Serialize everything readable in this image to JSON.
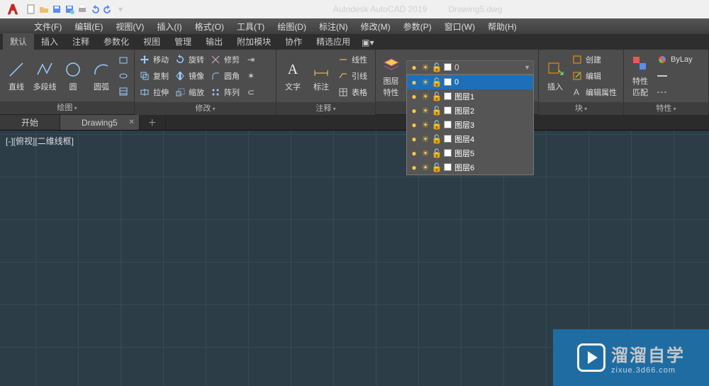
{
  "title": {
    "app": "Autodesk AutoCAD 2019",
    "file": "Drawing5.dwg"
  },
  "menu": [
    "文件(F)",
    "编辑(E)",
    "视图(V)",
    "插入(I)",
    "格式(O)",
    "工具(T)",
    "绘图(D)",
    "标注(N)",
    "修改(M)",
    "参数(P)",
    "窗口(W)",
    "帮助(H)"
  ],
  "tabs": [
    "默认",
    "插入",
    "注释",
    "参数化",
    "视图",
    "管理",
    "输出",
    "附加模块",
    "协作",
    "精选应用"
  ],
  "active_tab": 0,
  "panels": {
    "draw": {
      "title": "绘图",
      "btns": {
        "line": "直线",
        "polyline": "多段线",
        "circle": "圆",
        "arc": "圆弧"
      }
    },
    "modify": {
      "title": "修改",
      "btns": {
        "move": "移动",
        "rotate": "旋转",
        "trim": "修剪",
        "copy": "复制",
        "mirror": "镜像",
        "fillet": "圆角",
        "stretch": "拉伸",
        "scale": "缩放",
        "array": "阵列"
      }
    },
    "annot": {
      "title": "注释",
      "btns": {
        "text": "文字",
        "dim": "标注",
        "linear": "线性",
        "leader": "引线",
        "table": "表格"
      }
    },
    "layers": {
      "title": "图层",
      "btn": "图层\n特性",
      "selected": "0",
      "list": [
        "0",
        "图层1",
        "图层2",
        "图层3",
        "图层4",
        "图层5",
        "图层6"
      ]
    },
    "block": {
      "title": "块",
      "insert": "插入",
      "create": "创建",
      "edit": "编辑",
      "attr": "编辑属性"
    },
    "prop": {
      "title": "特性",
      "btn": "特性\n匹配",
      "bylayer": "ByLay"
    }
  },
  "filetabs": {
    "start": "开始",
    "drawing": "Drawing5"
  },
  "viewport_label": "[-][俯视][二维线框]",
  "watermark": {
    "big": "溜溜自学",
    "small": "zixue.3d66.com"
  }
}
